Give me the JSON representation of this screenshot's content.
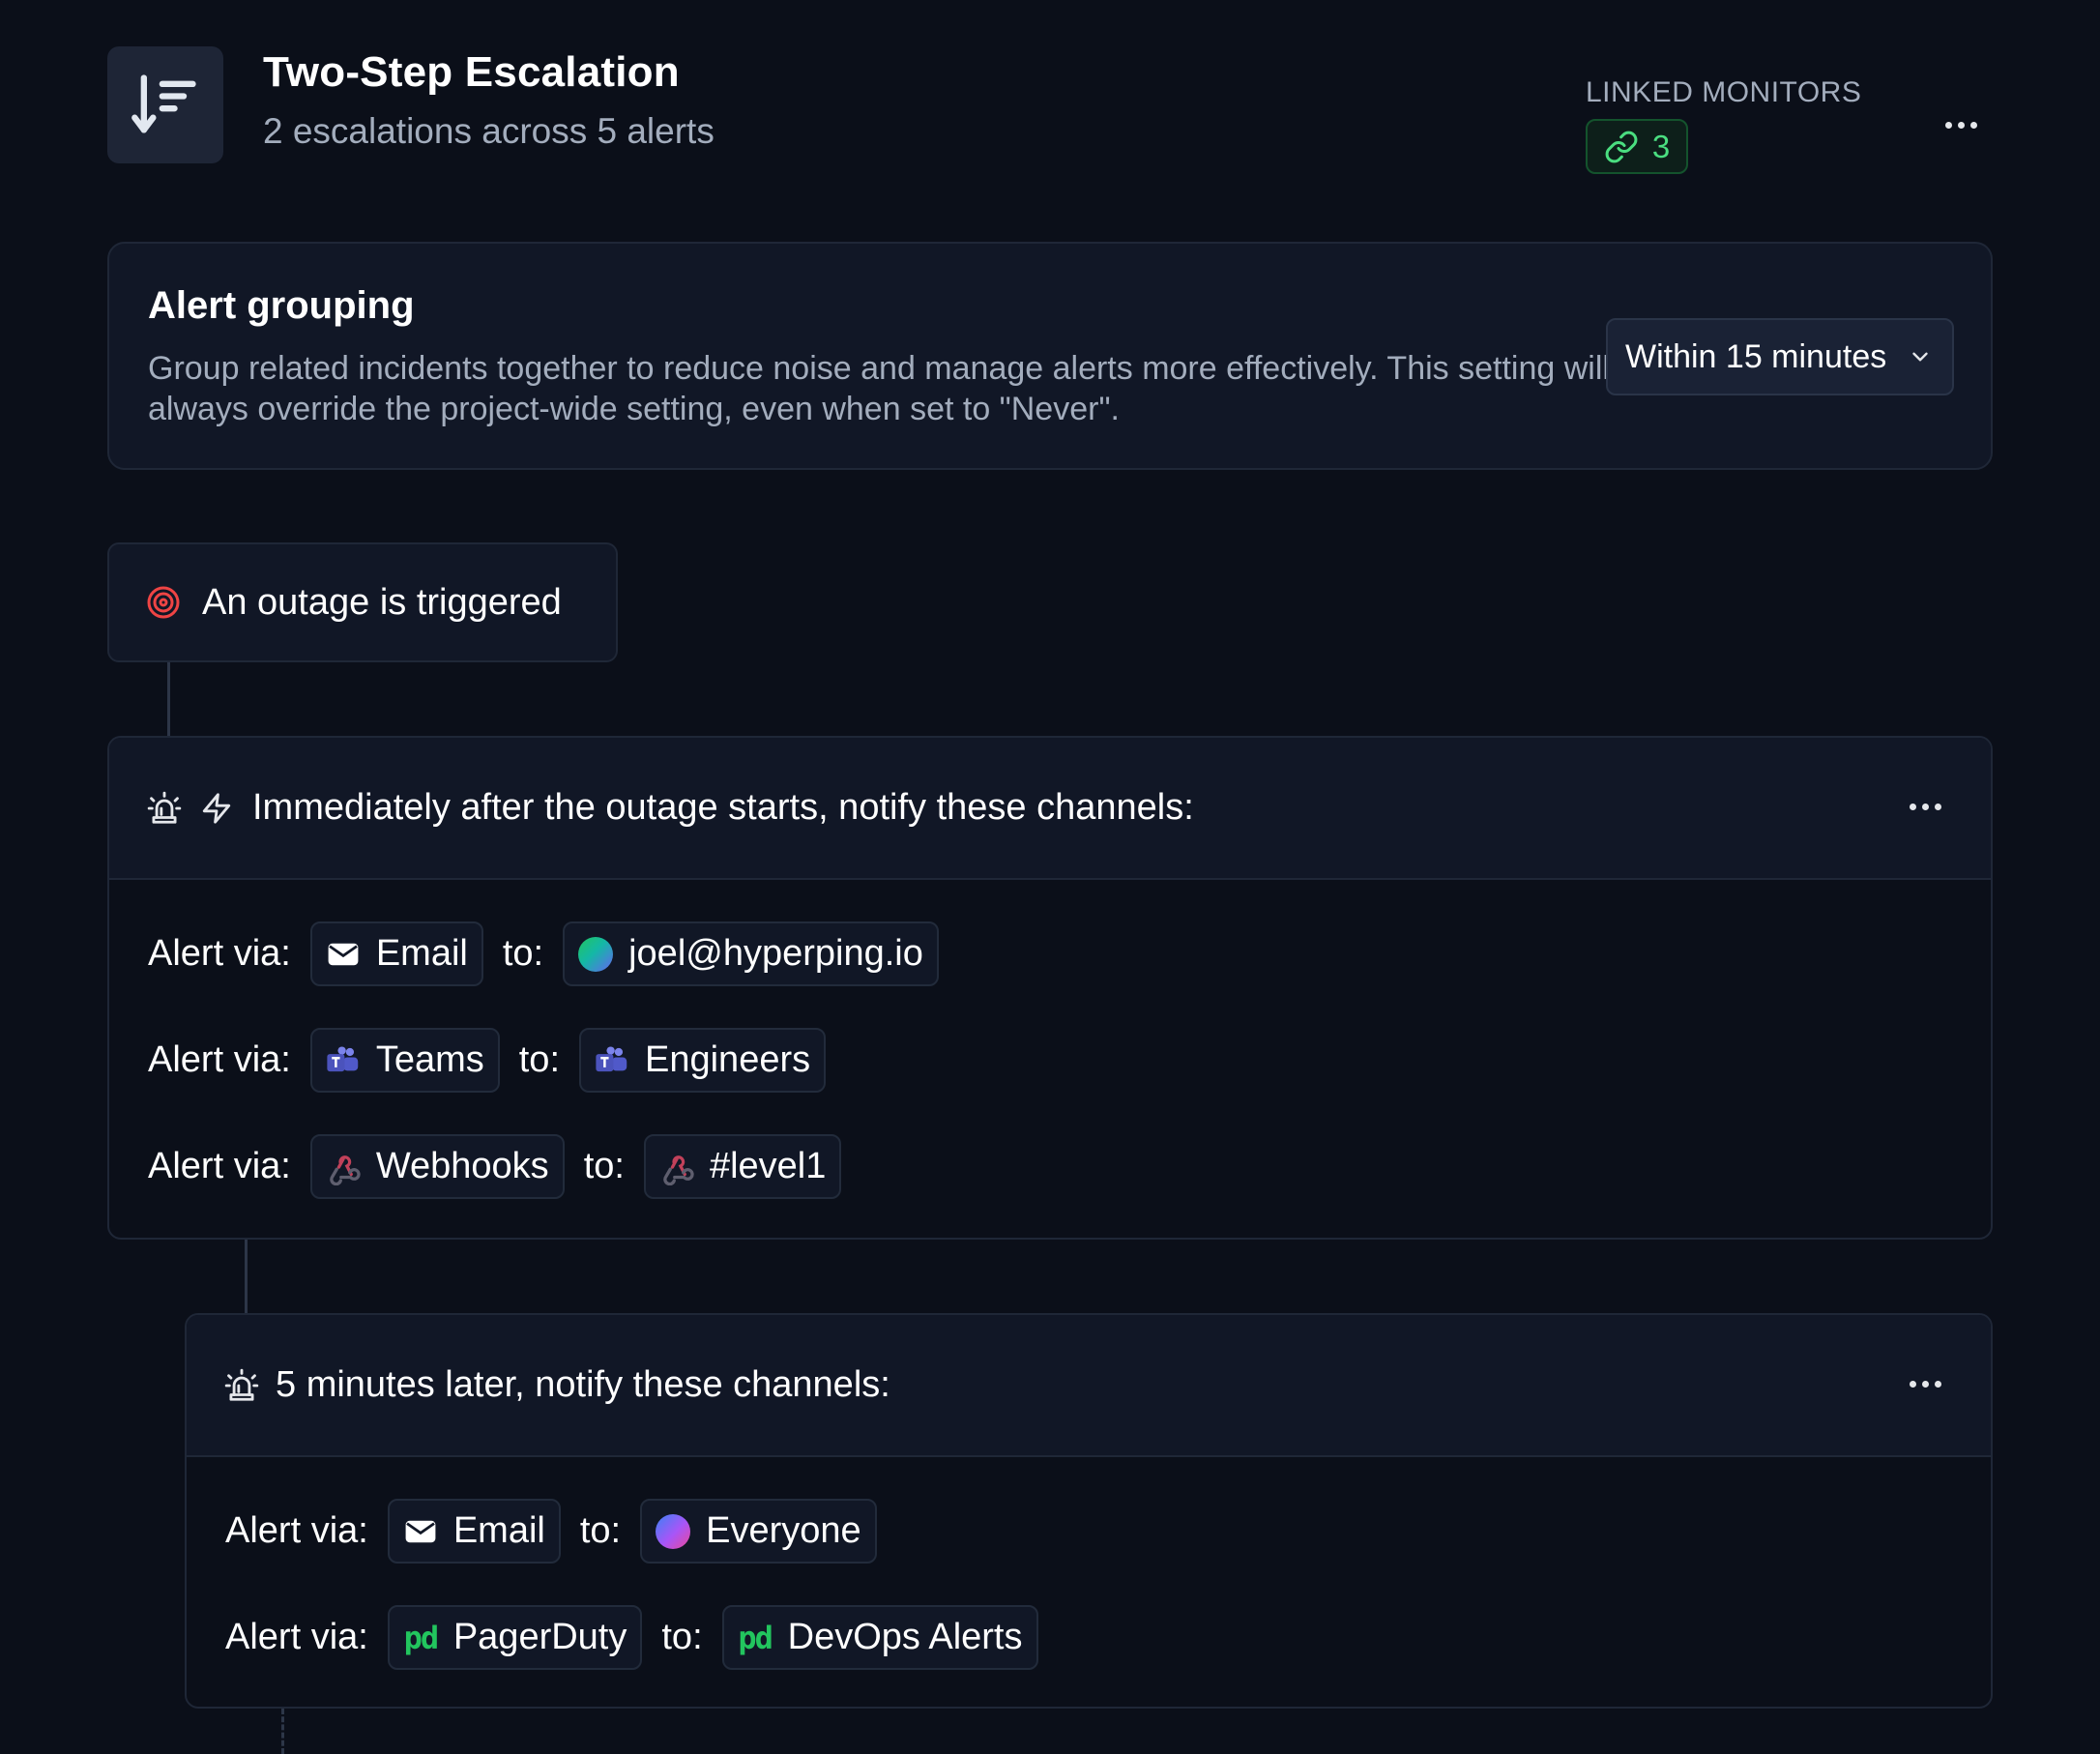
{
  "header": {
    "title": "Two-Step Escalation",
    "subtitle": "2 escalations across 5 alerts",
    "linked_monitors_label": "LINKED MONITORS",
    "linked_monitors_count": "3"
  },
  "grouping": {
    "title": "Alert grouping",
    "description": "Group related incidents together to reduce noise and manage alerts more effectively. This setting will always override the project-wide setting, even when set to \"Never\".",
    "selected": "Within 15 minutes"
  },
  "trigger": {
    "label": "An outage is triggered"
  },
  "steps": [
    {
      "heading": "Immediately after the outage starts, notify these channels:",
      "rows": [
        {
          "alert_label": "Alert via:",
          "channel": "Email",
          "to_label": "to:",
          "target": "joel@hyperping.io"
        },
        {
          "alert_label": "Alert via:",
          "channel": "Teams",
          "to_label": "to:",
          "target": "Engineers"
        },
        {
          "alert_label": "Alert via:",
          "channel": "Webhooks",
          "to_label": "to:",
          "target": "#level1"
        }
      ]
    },
    {
      "heading": "5 minutes later, notify these channels:",
      "rows": [
        {
          "alert_label": "Alert via:",
          "channel": "Email",
          "to_label": "to:",
          "target": "Everyone"
        },
        {
          "alert_label": "Alert via:",
          "channel": "PagerDuty",
          "to_label": "to:",
          "target": "DevOps Alerts"
        }
      ]
    }
  ],
  "icons": {
    "header": "sort-descending-icon",
    "link": "link-icon",
    "trigger": "target-icon",
    "siren": "siren-icon",
    "bolt": "bolt-icon",
    "email": "mail-icon",
    "teams": "teams-icon",
    "webhooks": "webhook-icon",
    "pagerduty": "pagerduty-icon",
    "pagerduty_text": "pd"
  },
  "colors": {
    "background": "#0b0f19",
    "card": "#111726",
    "accent_green": "#4ade80",
    "trigger_red": "#ef4444",
    "teams_purple": "#5b5fc7",
    "webhook_red": "#c2415a"
  }
}
